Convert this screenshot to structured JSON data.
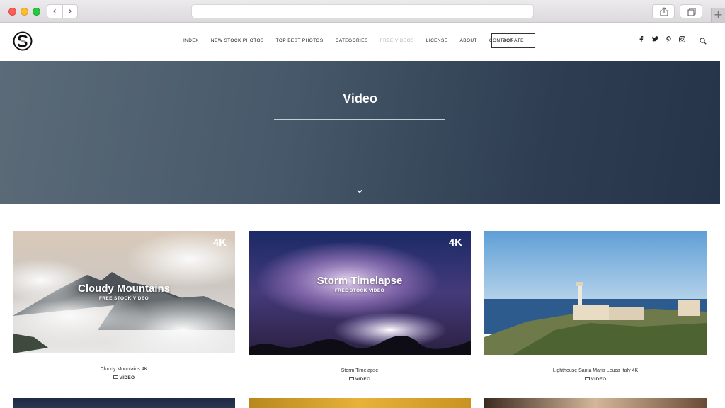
{
  "browser": {
    "back_glyph": "‹",
    "forward_glyph": "›",
    "new_tab_glyph": "+"
  },
  "header": {
    "logo_icon": "s-logo-icon",
    "menu": [
      "INDEX",
      "NEW STOCK PHOTOS",
      "TOP BEST PHOTOS",
      "CATEGORIES",
      "FREE VIDEOS",
      "LICENSE",
      "ABOUT",
      "CONTACT"
    ],
    "donate_label": "DONATE",
    "social_icons": [
      "facebook-icon",
      "twitter-icon",
      "pinterest-icon",
      "instagram-icon"
    ],
    "search_icon": "search-icon"
  },
  "hero": {
    "title": "Video"
  },
  "videos": [
    {
      "overlay_title": "Cloudy Mountains",
      "overlay_subtitle": "FREE STOCK VIDEO",
      "badge": "4K",
      "caption": "Cloudy Mountains 4K",
      "tag": "VIDEO"
    },
    {
      "overlay_title": "Storm Timelapse",
      "overlay_subtitle": "FREE STOCK VIDEO",
      "badge": "4K",
      "caption": "Storm Timelapse",
      "tag": "VIDEO"
    },
    {
      "overlay_title": "",
      "overlay_subtitle": "",
      "badge": "",
      "caption": "Lighthouse Santa Maria Leuca Italy 4K",
      "tag": "VIDEO"
    }
  ],
  "colors": {
    "hero_start": "#5b6b78",
    "hero_end": "#26344a",
    "menu_active": "#b5b5b5"
  }
}
